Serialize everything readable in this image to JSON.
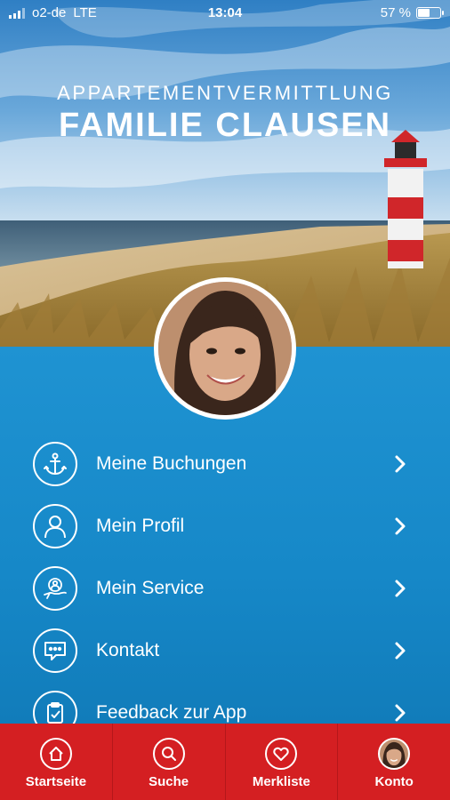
{
  "status_bar": {
    "carrier": "o2-de",
    "network": "LTE",
    "time": "13:04",
    "battery": "57 %",
    "battery_level": 0.57
  },
  "brand": {
    "subtitle": "APPARTEMENTVERMITTLUNG",
    "title": "FAMILIE CLAUSEN"
  },
  "menu": {
    "items": [
      {
        "label": "Meine Buchungen",
        "icon": "anchor-icon"
      },
      {
        "label": "Mein Profil",
        "icon": "user-icon"
      },
      {
        "label": "Mein Service",
        "icon": "service-hand-icon"
      },
      {
        "label": "Kontakt",
        "icon": "chat-icon"
      },
      {
        "label": "Feedback zur App",
        "icon": "clipboard-icon"
      }
    ]
  },
  "tabbar": {
    "items": [
      {
        "label": "Startseite",
        "icon": "home-icon"
      },
      {
        "label": "Suche",
        "icon": "search-icon"
      },
      {
        "label": "Merkliste",
        "icon": "heart-icon"
      },
      {
        "label": "Konto",
        "icon": "avatar-icon"
      }
    ]
  },
  "colors": {
    "panel_blue": "#1688c8",
    "tab_red": "#d41f22"
  }
}
